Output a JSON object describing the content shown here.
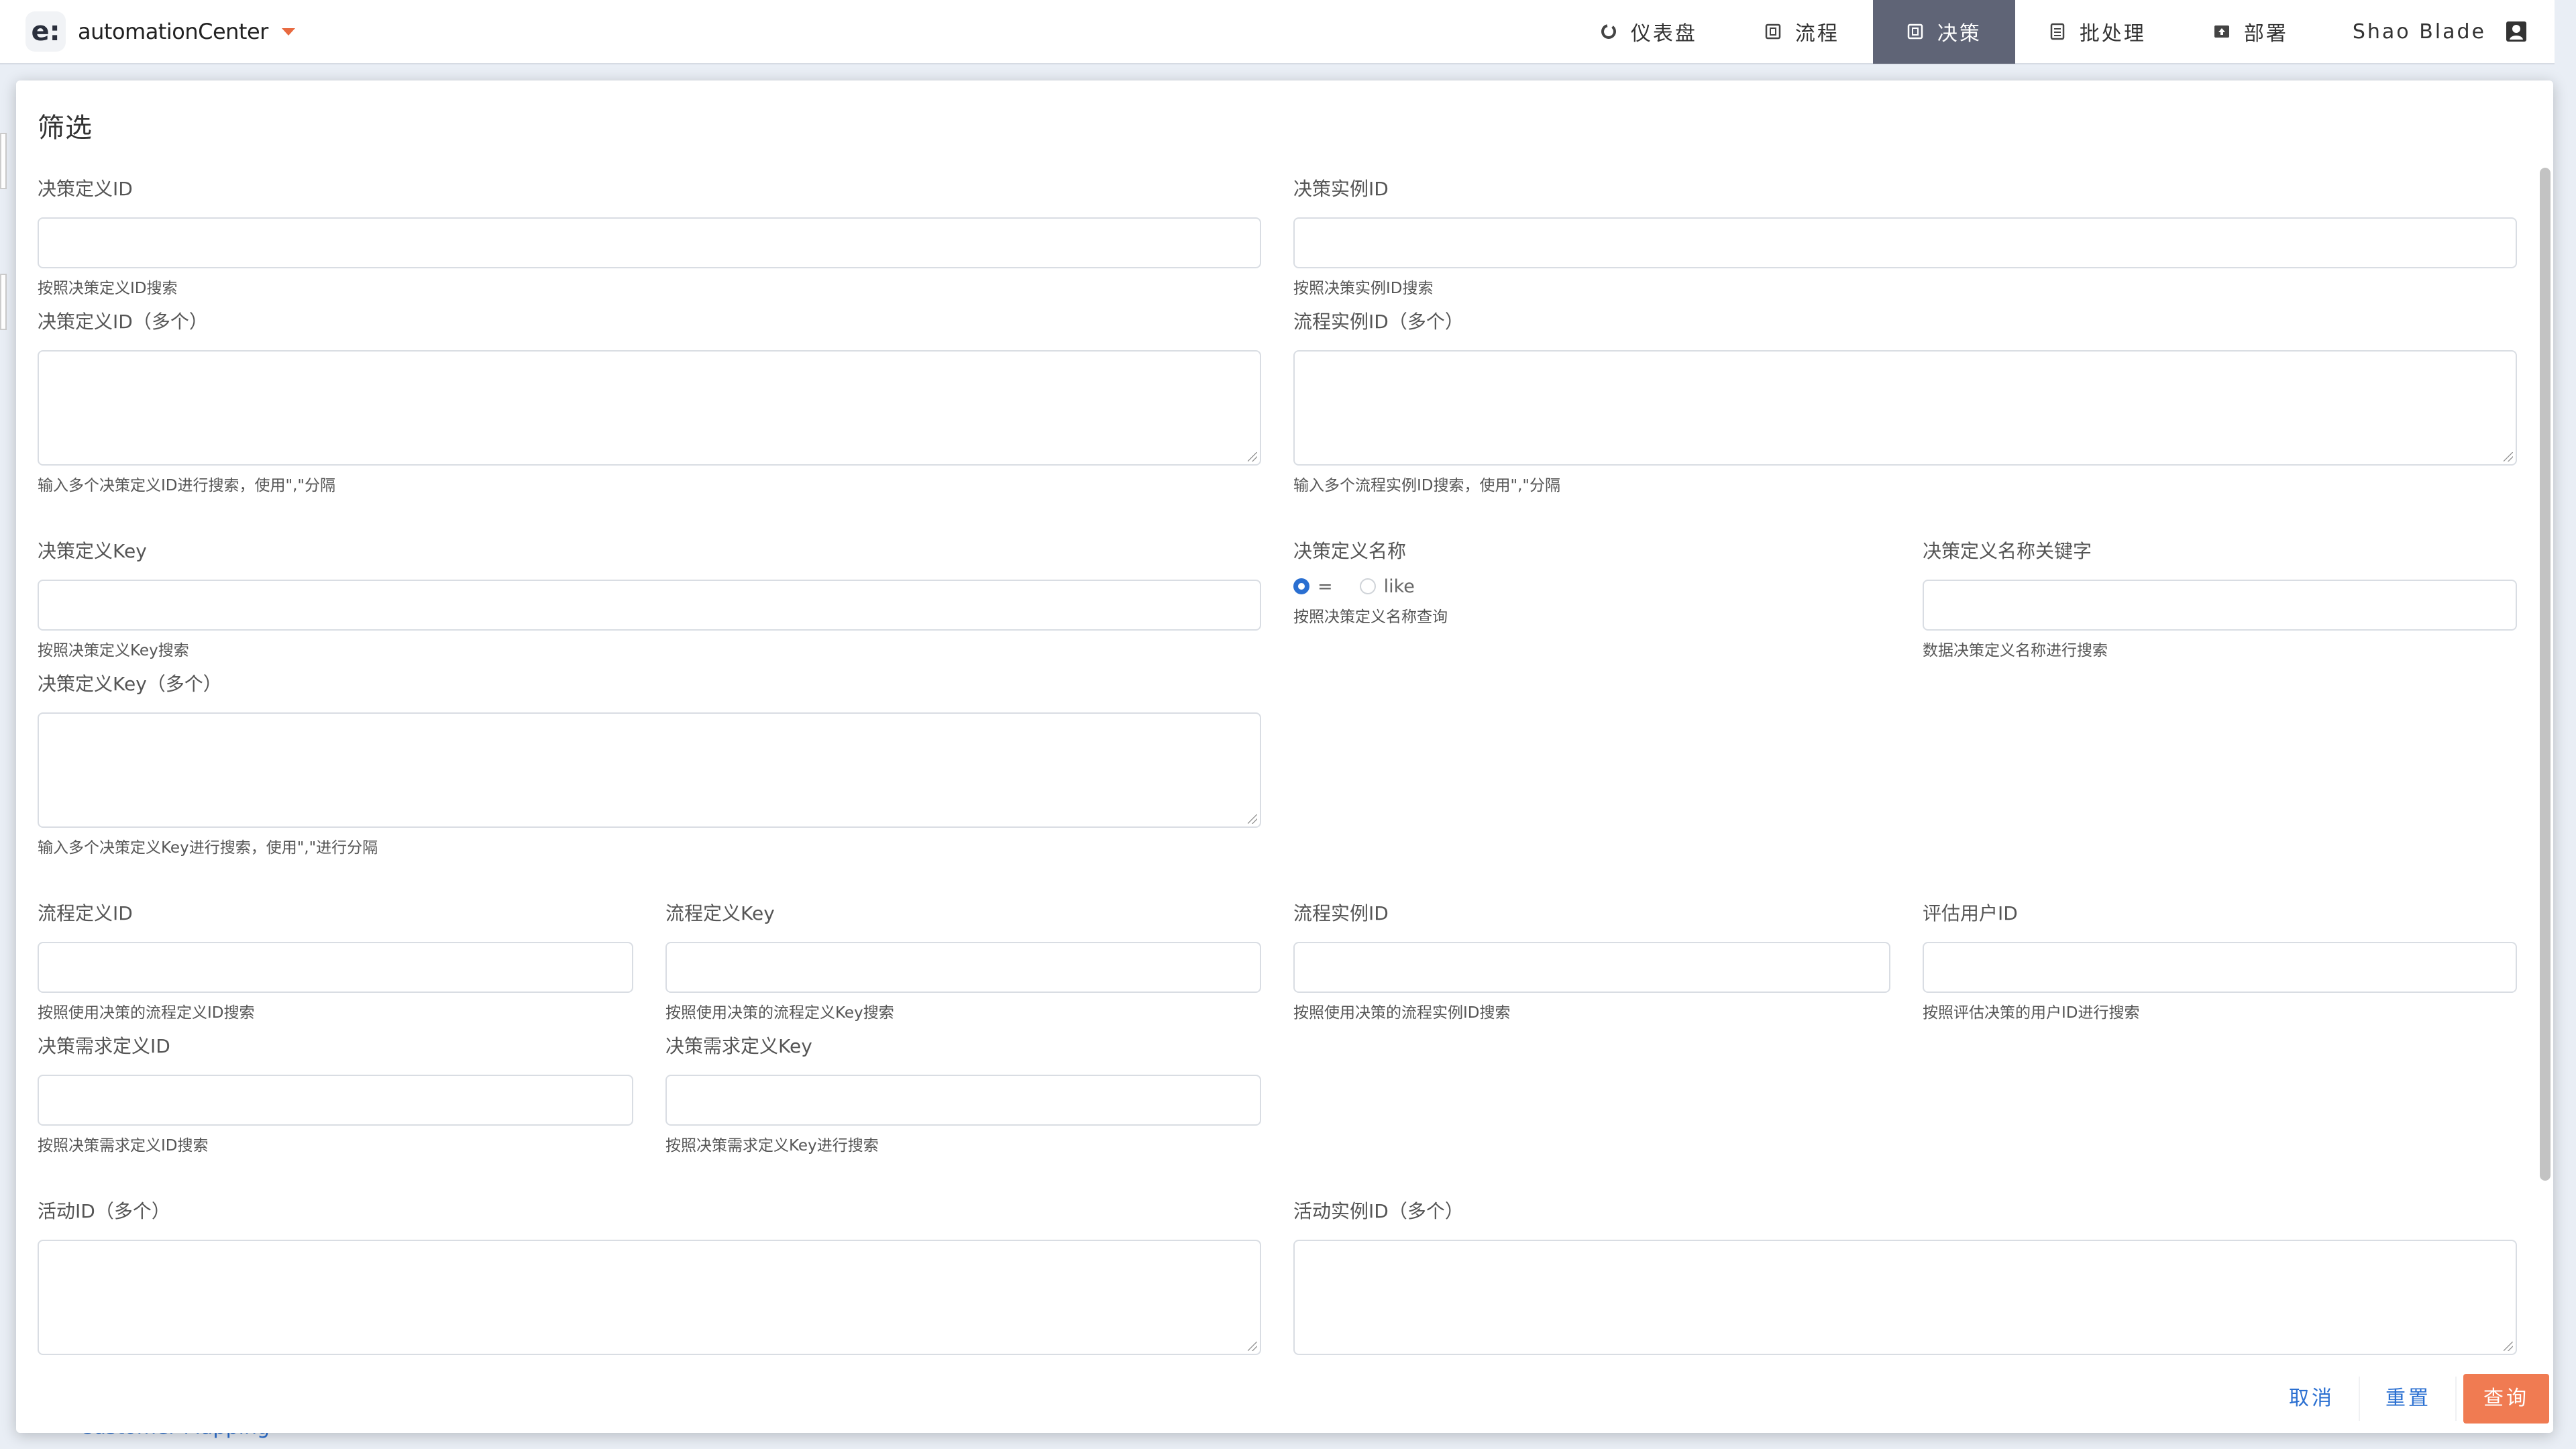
{
  "app": {
    "logo_letter": "e:",
    "name": "automationCenter"
  },
  "nav": {
    "items": [
      {
        "label": "仪表盘",
        "icon": "dashboard-icon"
      },
      {
        "label": "流程",
        "icon": "process-icon"
      },
      {
        "label": "决策",
        "icon": "decision-icon",
        "active": true
      },
      {
        "label": "批处理",
        "icon": "batch-icon"
      },
      {
        "label": "部署",
        "icon": "deployment-icon"
      }
    ],
    "user": "Shao Blade"
  },
  "background": {
    "link_text": "Customer Mapping"
  },
  "modal": {
    "title": "筛选",
    "fields": {
      "decision_def_id": {
        "label": "决策定义ID",
        "help": "按照决策定义ID搜索",
        "value": ""
      },
      "decision_instance_id": {
        "label": "决策实例ID",
        "help": "按照决策实例ID搜索",
        "value": ""
      },
      "decision_def_ids": {
        "label": "决策定义ID（多个）",
        "help": "输入多个决策定义ID进行搜索，使用\",\"分隔",
        "value": ""
      },
      "process_instance_ids": {
        "label": "流程实例ID（多个）",
        "help": "输入多个流程实例ID搜索，使用\",\"分隔",
        "value": ""
      },
      "decision_def_key": {
        "label": "决策定义Key",
        "help": "按照决策定义Key搜索",
        "value": ""
      },
      "decision_def_name": {
        "label": "决策定义名称",
        "help": "按照决策定义名称查询",
        "options": [
          "=",
          "like"
        ],
        "selected": "="
      },
      "decision_def_name_like": {
        "label": "决策定义名称关键字",
        "help": "数据决策定义名称进行搜索",
        "value": ""
      },
      "decision_def_keys": {
        "label": "决策定义Key（多个）",
        "help": "输入多个决策定义Key进行搜索，使用\",\"进行分隔",
        "value": ""
      },
      "process_def_id": {
        "label": "流程定义ID",
        "help": "按照使用决策的流程定义ID搜索",
        "value": ""
      },
      "process_def_key": {
        "label": "流程定义Key",
        "help": "按照使用决策的流程定义Key搜索",
        "value": ""
      },
      "process_instance_id": {
        "label": "流程实例ID",
        "help": "按照使用决策的流程实例ID搜索",
        "value": ""
      },
      "user_id": {
        "label": "评估用户ID",
        "help": "按照评估决策的用户ID进行搜索",
        "value": ""
      },
      "drd_id": {
        "label": "决策需求定义ID",
        "help": "按照决策需求定义ID搜索",
        "value": ""
      },
      "drd_key": {
        "label": "决策需求定义Key",
        "help": "按照决策需求定义Key进行搜索",
        "value": ""
      },
      "activity_ids": {
        "label": "活动ID（多个）",
        "value": ""
      },
      "activity_instance_ids": {
        "label": "活动实例ID（多个）",
        "value": ""
      }
    },
    "buttons": {
      "cancel": "取消",
      "reset": "重置",
      "query": "查询"
    }
  },
  "colors": {
    "nav_active_bg": "#5f6476",
    "primary_link": "#2a6fd1",
    "query_button": "#f07b52",
    "brand_caret": "#e86a40"
  }
}
